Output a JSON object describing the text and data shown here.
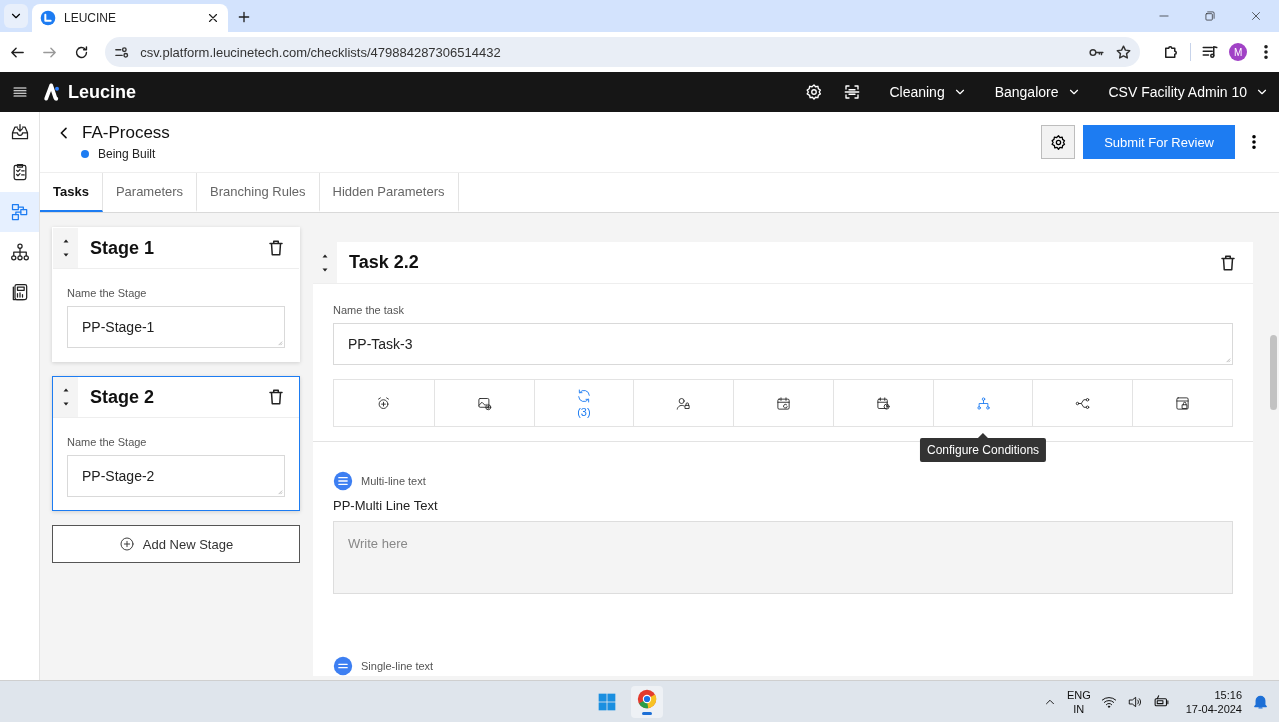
{
  "browser": {
    "tab_title": "LEUCINE",
    "url": "csv.platform.leucinetech.com/checklists/479884287306514432",
    "profile_initial": "M"
  },
  "app_header": {
    "brand": "Leucine",
    "menus": [
      {
        "label": "Cleaning"
      },
      {
        "label": "Bangalore"
      },
      {
        "label": "CSV Facility Admin 10"
      }
    ]
  },
  "sidebar": {
    "items": [
      {
        "kind": "inbox",
        "selected": false
      },
      {
        "kind": "checklists",
        "selected": false
      },
      {
        "kind": "processes",
        "selected": true
      },
      {
        "kind": "ontology",
        "selected": false
      },
      {
        "kind": "reports",
        "selected": false
      }
    ]
  },
  "process": {
    "title": "FA-Process",
    "status": "Being Built",
    "primary_button": "Submit For Review"
  },
  "tabs": [
    {
      "label": "Tasks",
      "selected": true
    },
    {
      "label": "Parameters",
      "selected": false
    },
    {
      "label": "Branching Rules",
      "selected": false
    },
    {
      "label": "Hidden Parameters",
      "selected": false
    }
  ],
  "stages": [
    {
      "title": "Stage 1",
      "field_label": "Name the Stage",
      "value": "PP-Stage-1",
      "selected": false
    },
    {
      "title": "Stage 2",
      "field_label": "Name the Stage",
      "value": "PP-Stage-2",
      "selected": true
    }
  ],
  "add_stage_button": "Add New Stage",
  "task": {
    "title": "Task 2.2",
    "field_label": "Name the task",
    "value": "PP-Task-3",
    "actions": [
      {
        "kind": "timer",
        "active": false
      },
      {
        "kind": "media",
        "active": false
      },
      {
        "kind": "recurrence",
        "active": true,
        "count": "(3)"
      },
      {
        "kind": "assignee",
        "active": false
      },
      {
        "kind": "schedule",
        "active": false
      },
      {
        "kind": "due",
        "active": false
      },
      {
        "kind": "conditions",
        "active": true,
        "tooltip": "Configure Conditions"
      },
      {
        "kind": "branching",
        "active": false
      },
      {
        "kind": "lock",
        "active": false
      }
    ],
    "parameters": [
      {
        "kind": "multi_line",
        "type_label": "Multi-line text",
        "name": "PP-Multi Line Text",
        "placeholder": "Write here"
      },
      {
        "kind": "single_line",
        "type_label": "Single-line text"
      }
    ]
  },
  "taskbar": {
    "language": "ENG",
    "region": "IN",
    "time": "15:16",
    "date": "17-04-2024"
  }
}
